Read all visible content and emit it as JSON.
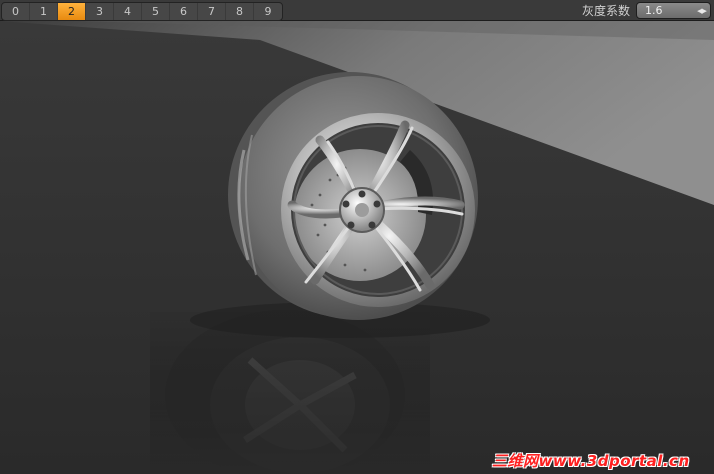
{
  "toolbar": {
    "frames": [
      "0",
      "1",
      "2",
      "3",
      "4",
      "5",
      "6",
      "7",
      "8",
      "9"
    ],
    "active_frame": "2",
    "gray_label": "灰度系数",
    "gray_value": "1.6",
    "spinner_icon": "left-right-arrows-icon"
  },
  "watermark": {
    "text": "三维网www.3dportal.cn"
  },
  "colors": {
    "active_tab": "#f09a1c",
    "watermark": "#ff2020",
    "background": "#2c2c2c"
  }
}
